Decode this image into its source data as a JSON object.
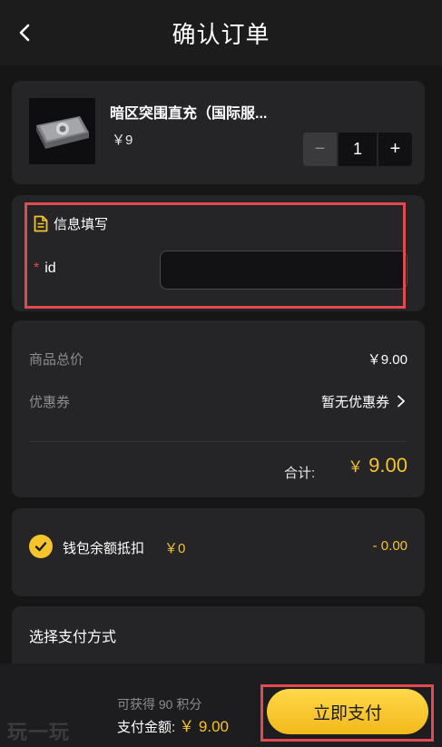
{
  "header": {
    "title": "确认订单",
    "back_icon": "chevron-left-icon"
  },
  "product": {
    "name": "暗区突围直充（国际服...",
    "price": "￥9",
    "quantity": "1",
    "minus_label": "−",
    "plus_label": "+"
  },
  "info": {
    "title": "信息填写",
    "icon": "document-icon",
    "required_mark": "*",
    "id_label": "id",
    "id_value": ""
  },
  "summary": {
    "total_price_label": "商品总价",
    "total_price_value": "￥9.00",
    "coupon_label": "优惠券",
    "coupon_value": "暂无优惠券",
    "subtotal_label": "合计:",
    "subtotal_currency": "￥",
    "subtotal_value": "9.00"
  },
  "wallet": {
    "label": "钱包余额抵扣",
    "balance": "￥0",
    "deduct": "- 0.00",
    "checked": true
  },
  "payment": {
    "title": "选择支付方式"
  },
  "bottom": {
    "points_text": "可获得 90 积分",
    "pay_amount_label": "支付金额:",
    "pay_amount_value": "￥ 9.00",
    "pay_button": "立即支付",
    "logo": "玩一玩"
  },
  "colors": {
    "accent": "#f5c32c",
    "highlight": "#e04a50",
    "card": "#252527",
    "background": "#161616"
  }
}
